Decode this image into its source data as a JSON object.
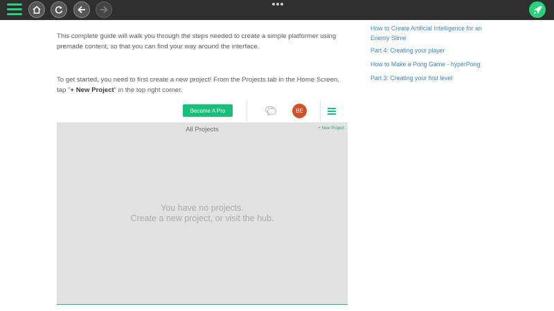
{
  "toolbar": {
    "menu_icon": "hamburger-icon",
    "buttons": [
      "home-icon",
      "refresh-icon",
      "back-arrow-icon",
      "forward-arrow-icon"
    ],
    "more_icon": "more-dots-icon",
    "launch_icon": "rocket-icon",
    "accent": "#2bd07b"
  },
  "article": {
    "intro": "This complete guide will walk you through the steps needed to create a simple platformer using premade content, so that you can find your way around the interface.",
    "start_part1": "To get started, you need to first create a new project! From the Projects tab in the Home Screen, tap \"",
    "start_bold": "+ New Project",
    "start_part2": "\" in the top right corner."
  },
  "screenshot": {
    "become_pro": "Become A Pro",
    "avatar_initials": "BE",
    "panel_title": "All Projects",
    "new_project_link": "+ New Project",
    "empty_line1": "You have no projects.",
    "empty_line2": "Create a new project, or visit the hub."
  },
  "sidebar": {
    "links": [
      "How to Create Artificial Intelligence for an Enemy Slime",
      "Part 4: Creating your player",
      "How to Make a Pong Game - hyperPong",
      "Part 3: Creating your first level"
    ]
  }
}
